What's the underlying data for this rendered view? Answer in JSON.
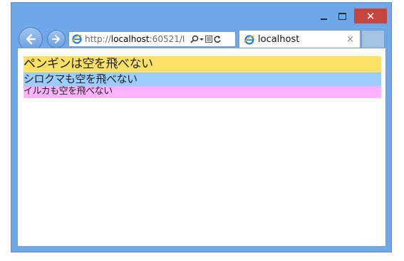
{
  "titlebar": {
    "minimize_icon": "minimize-icon",
    "maximize_icon": "maximize-icon",
    "close_label": "✕"
  },
  "nav": {
    "back_icon": "arrow-left-icon",
    "forward_icon": "arrow-right-icon"
  },
  "address_bar": {
    "url_prefix": "http://",
    "url_host": "localhost",
    "url_rest": ":60521/I",
    "search_icon": "search-icon",
    "dropdown_icon": "chevron-down-icon",
    "compat_icon": "compatibility-icon",
    "refresh_icon": "refresh-icon"
  },
  "tab": {
    "title": "localhost",
    "close_label": "×"
  },
  "page": {
    "lines": [
      {
        "text": "ペンギンは空を飛べない",
        "bg": "#ffe066"
      },
      {
        "text": "シロクマも空を飛べない",
        "bg": "#99ccff"
      },
      {
        "text": "イルカも空を飛べない",
        "bg": "#ffb3ff"
      }
    ]
  },
  "colors": {
    "frame": "#6fa8e8",
    "close_button": "#c7453f"
  }
}
